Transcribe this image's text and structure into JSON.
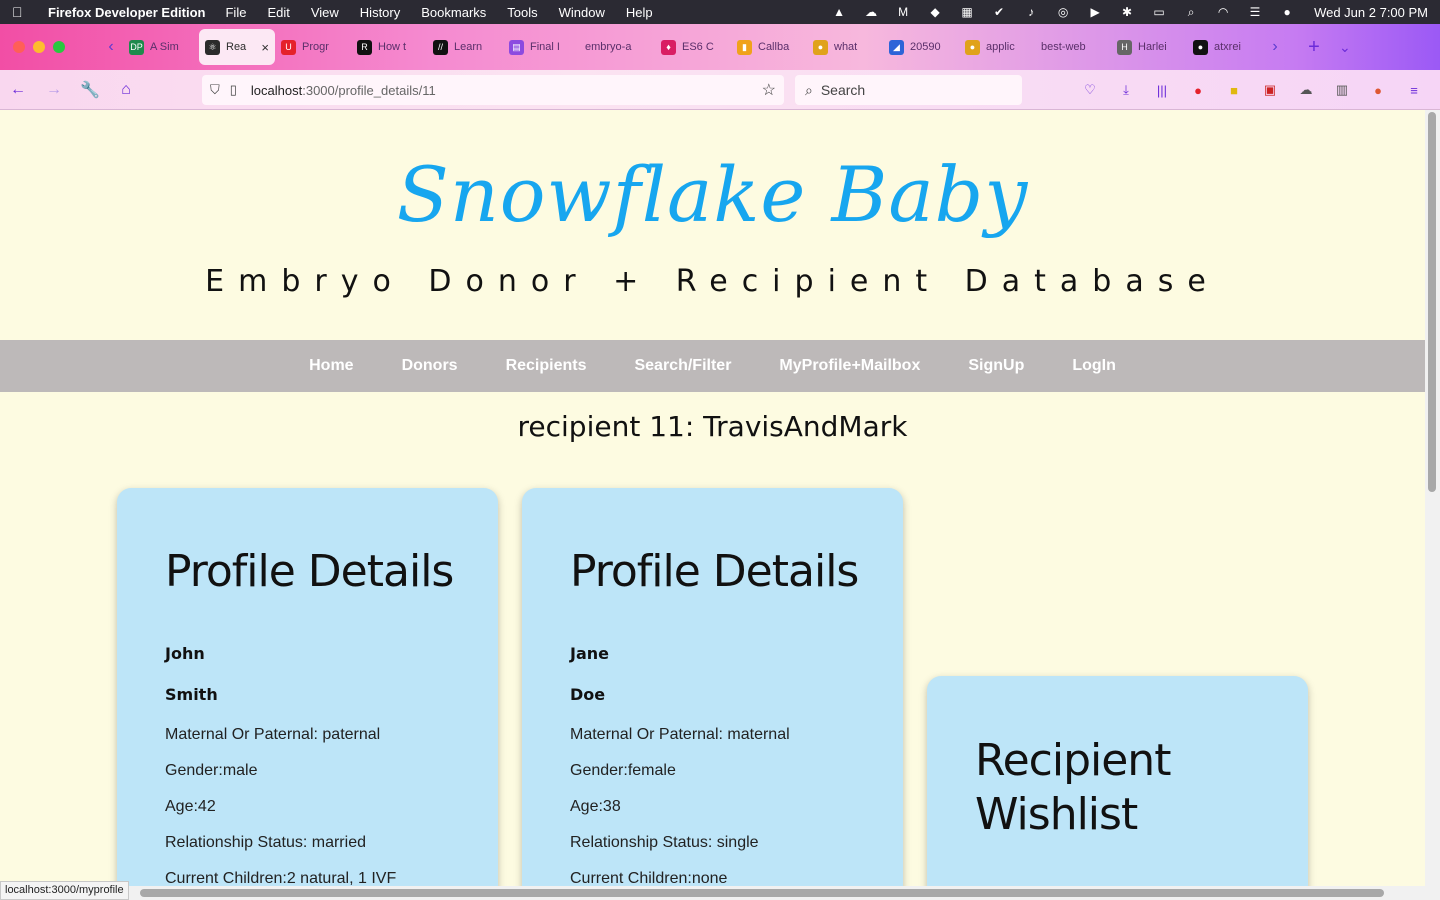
{
  "menubar": {
    "app": "Firefox Developer Edition",
    "items": [
      "File",
      "Edit",
      "View",
      "History",
      "Bookmarks",
      "Tools",
      "Window",
      "Help"
    ],
    "clock": "Wed Jun 2  7:00 PM"
  },
  "tabs": [
    {
      "label": "A Sim",
      "fav": "DP",
      "color": "#1f8a4c"
    },
    {
      "label": "Rea",
      "fav": "⚛",
      "color": "#2b2b2b",
      "active": true
    },
    {
      "label": "Progr",
      "fav": "U",
      "color": "#e5212b"
    },
    {
      "label": "How t",
      "fav": "R",
      "color": "#111111"
    },
    {
      "label": "Learn",
      "fav": "//",
      "color": "#111111"
    },
    {
      "label": "Final I",
      "fav": "▤",
      "color": "#8c4ae0"
    },
    {
      "label": "embryo-a",
      "fav": "",
      "color": "transparent"
    },
    {
      "label": "ES6 C",
      "fav": "♦",
      "color": "#d91d63"
    },
    {
      "label": "Callba",
      "fav": "▮",
      "color": "#f0a21b"
    },
    {
      "label": "what",
      "fav": "●",
      "color": "#e0a21b"
    },
    {
      "label": "20590",
      "fav": "◢",
      "color": "#2d64d8"
    },
    {
      "label": "applic",
      "fav": "●",
      "color": "#e0a21b"
    },
    {
      "label": "best-web",
      "fav": "",
      "color": "transparent"
    },
    {
      "label": "Harlei",
      "fav": "H",
      "color": "#666666"
    },
    {
      "label": "atxrei",
      "fav": "●",
      "color": "#111111"
    }
  ],
  "toolbar": {
    "url_host": "localhost",
    "url_path": ":3000/profile_details/11",
    "search_placeholder": "Search"
  },
  "status_url": "localhost:3000/myprofile",
  "site": {
    "logo": "Snowflake Baby",
    "tagline": "Embryo Donor + Recipient Database",
    "nav": [
      "Home",
      "Donors",
      "Recipients",
      "Search/Filter",
      "MyProfile+Mailbox",
      "SignUp",
      "LogIn"
    ],
    "page_title": "recipient 11: TravisAndMark"
  },
  "cards": {
    "first": {
      "heading": "Profile Details",
      "first_name": "John",
      "last_name": "Smith",
      "maternal_paternal": "Maternal Or Paternal: paternal",
      "gender": "Gender:male",
      "age": "Age:42",
      "relationship": "Relationship Status: married",
      "children": "Current Children:2 natural, 1 IVF"
    },
    "second": {
      "heading": "Profile Details",
      "first_name": "Jane",
      "last_name": "Doe",
      "maternal_paternal": "Maternal Or Paternal: maternal",
      "gender": "Gender:female",
      "age": "Age:38",
      "relationship": "Relationship Status: single",
      "children": "Current Children:none"
    },
    "wishlist": {
      "heading_line1": "Recipient",
      "heading_line2": "Wishlist"
    }
  }
}
